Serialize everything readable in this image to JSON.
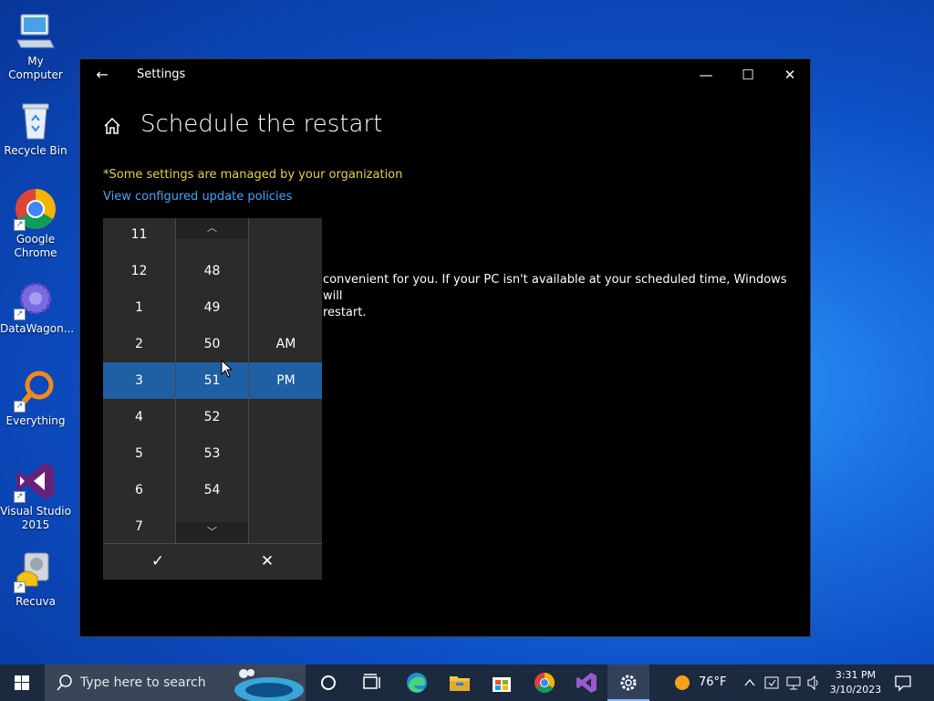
{
  "desktop": {
    "icons": [
      {
        "label": "My Computer"
      },
      {
        "label": "Recycle Bin"
      },
      {
        "label": "Google Chrome"
      },
      {
        "label": "DataWagon..."
      },
      {
        "label": "Everything"
      },
      {
        "label": "Visual Studio 2015"
      },
      {
        "label": "Recuva"
      }
    ]
  },
  "window": {
    "title": "Settings",
    "back_glyph": "←",
    "minimize_glyph": "—",
    "maximize_glyph": "☐",
    "close_glyph": "✕",
    "page_title": "Schedule the restart",
    "managed_note": "*Some settings are managed by your organization",
    "policies_link": "View configured update policies",
    "body_line1": "convenient for you. If your PC isn't available at your scheduled time, Windows will",
    "body_line2": "restart."
  },
  "time_picker": {
    "hours": [
      "11",
      "12",
      "1",
      "2",
      "3",
      "4",
      "5",
      "6",
      "7"
    ],
    "minutes": [
      "48",
      "49",
      "50",
      "51",
      "52",
      "53",
      "54"
    ],
    "ampm": [
      "AM",
      "PM"
    ],
    "selected": {
      "hour": "3",
      "minute": "51",
      "period": "PM"
    },
    "scroll_up_glyph": "︿",
    "scroll_down_glyph": "﹀",
    "accept_glyph": "✓",
    "dismiss_glyph": "✕"
  },
  "taskbar": {
    "search_placeholder": "Type here to search",
    "pinned": [
      "cortana-icon",
      "task-view-icon",
      "edge-icon",
      "file-explorer-icon",
      "store-icon",
      "chrome-icon",
      "visual-studio-icon",
      "settings-icon"
    ],
    "weather": "76°F",
    "clock_time": "3:31 PM",
    "clock_date": "3/10/2023"
  },
  "colors": {
    "selection": "#1f5fa3",
    "link": "#4aa3ff",
    "warning_text": "#e6d24a",
    "picker_bg": "#2b2b2b"
  }
}
